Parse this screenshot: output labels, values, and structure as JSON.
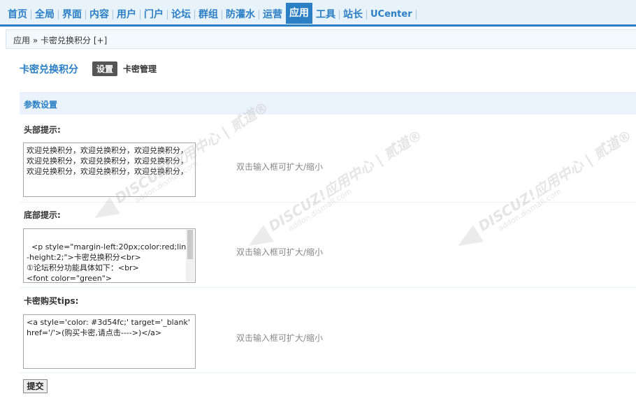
{
  "nav": {
    "items": [
      {
        "label": "首页"
      },
      {
        "label": "全局"
      },
      {
        "label": "界面"
      },
      {
        "label": "内容"
      },
      {
        "label": "用户"
      },
      {
        "label": "门户"
      },
      {
        "label": "论坛"
      },
      {
        "label": "群组"
      },
      {
        "label": "防灌水"
      },
      {
        "label": "运营"
      },
      {
        "label": "应用",
        "active": true
      },
      {
        "label": "工具"
      },
      {
        "label": "站长"
      },
      {
        "label": "UCenter"
      }
    ]
  },
  "breadcrumb": {
    "root": "应用",
    "separator": "»",
    "current": "卡密兑换积分",
    "add": "[+]"
  },
  "plugin": {
    "title": "卡密兑换积分",
    "tab_active": "设置",
    "tab_other": "卡密管理"
  },
  "section": {
    "title": "参数设置"
  },
  "fields": [
    {
      "label": "头部提示:",
      "value": "欢迎兑换积分，欢迎兑换积分，欢迎兑换积分，欢迎兑换积分，欢迎兑换积分，欢迎兑换积分，欢迎兑换积分，欢迎兑换积分，欢迎兑换积分，",
      "hint": "双击输入框可扩大/缩小"
    },
    {
      "label": "底部提示:",
      "value": "<p style=\"margin-left:20px;color:red;line-height:2;\">卡密兑换积分<br>\n①论坛积分功能具体如下：<br>\n<font color=\"green\">",
      "hint": "双击输入框可扩大/缩小"
    },
    {
      "label": "卡密购买tips:",
      "value": "<a style='color: #3d54fc;' target='_blank' href='/'>(购买卡密,请点击---->)</a>",
      "hint": "双击输入框可扩大/缩小"
    }
  ],
  "submit": {
    "label": "提交"
  },
  "watermark": {
    "brand": "DISCUZ!应用中心 | 贰道®",
    "url": "addon.dismall.com"
  }
}
